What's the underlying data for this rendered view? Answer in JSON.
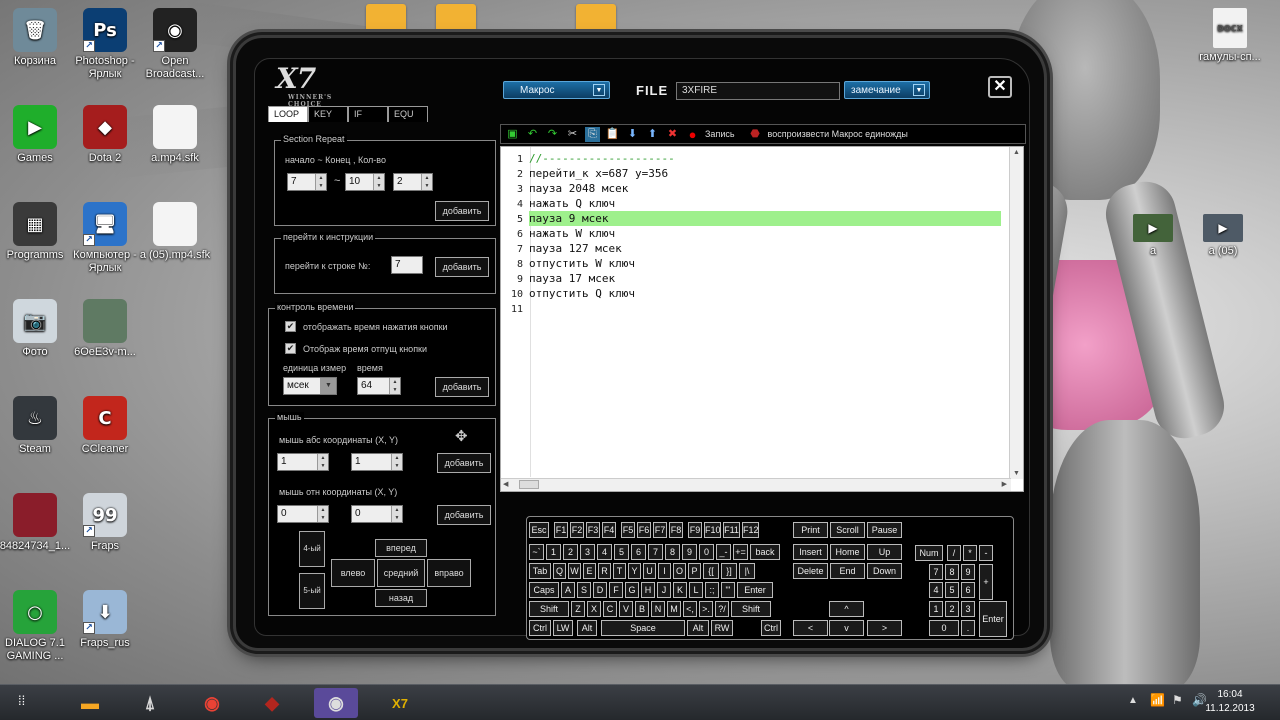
{
  "desktop": {
    "icons_left": [
      {
        "label": "Корзина",
        "glyph": "🗑",
        "color": "#6f8a99",
        "shortcut": false
      },
      {
        "label": "Photoshop - Ярлык",
        "glyph": "Ps",
        "color": "#0b3e73",
        "shortcut": true
      },
      {
        "label": "Open Broadcast...",
        "glyph": "◉",
        "color": "#222222",
        "shortcut": true
      },
      {
        "label": "Games",
        "glyph": "▶",
        "color": "#1fae2b",
        "shortcut": false
      },
      {
        "label": "Dota 2",
        "glyph": "◆",
        "color": "#a51d1d",
        "shortcut": false
      },
      {
        "label": "a.mp4.sfk",
        "glyph": "",
        "color": "#f4f4f4",
        "shortcut": false
      },
      {
        "label": "Programms",
        "glyph": "▦",
        "color": "#3a3a3a",
        "shortcut": false
      },
      {
        "label": "Компьютер - Ярлык",
        "glyph": "🖥",
        "color": "#2c73c9",
        "shortcut": true
      },
      {
        "label": "a (05).mp4.sfk",
        "glyph": "",
        "color": "#f4f4f4",
        "shortcut": false
      },
      {
        "label": "Фото",
        "glyph": "📷",
        "color": "#cfd7dd",
        "shortcut": false
      },
      {
        "label": "6OeE3v-m...",
        "glyph": "",
        "color": "#5f7a63",
        "shortcut": false
      },
      {
        "label": "Steam",
        "glyph": "♨",
        "color": "#33383d",
        "shortcut": false
      },
      {
        "label": "CCleaner",
        "glyph": "C",
        "color": "#c2261c",
        "shortcut": false
      },
      {
        "label": "84824734_1...",
        "glyph": "",
        "color": "#8a1d2a",
        "shortcut": false
      },
      {
        "label": "Fraps",
        "glyph": "99",
        "color": "#cfd5db",
        "shortcut": true
      },
      {
        "label": "DIALOG 7.1 GAMING ...",
        "glyph": "○",
        "color": "#26a33a",
        "shortcut": false
      },
      {
        "label": "Fraps_rus",
        "glyph": "⬇",
        "color": "#9ab7d6",
        "shortcut": true
      }
    ],
    "icons_right": [
      {
        "label": "гамулы-сп...",
        "glyph": "DOCX",
        "color": "#f2f2f2"
      },
      {
        "label": "а",
        "glyph": "▶",
        "color": "#43633a"
      },
      {
        "label": "а (05)",
        "glyph": "▶",
        "color": "#4e5a66"
      }
    ],
    "top_folder_icons": [
      "#f2b233",
      "#f2b233",
      "#f2b233"
    ]
  },
  "app": {
    "logo": "X7",
    "logo_sub": "WINNER'S CHOICE",
    "macro_dropdown": "Макрос",
    "file_label": "FILE",
    "file_name": "3XFIRE",
    "note_dropdown": "замечание",
    "close_glyph": "✕",
    "tabs": [
      "LOOP",
      "KEY",
      "IF",
      "EQU"
    ],
    "section_repeat": {
      "title": "Section Repeat",
      "subtitle": "начало ~ Конец , Кол-во",
      "start": "7",
      "tilde": "~",
      "end": "10",
      "count": "2",
      "add": "добавить"
    },
    "goto": {
      "title": "перейти к инструкции",
      "label": "перейти к строке №:",
      "value": "7",
      "add": "добавить"
    },
    "time_control": {
      "title": "контроль времени",
      "check1": "отображать время нажатия кнопки",
      "check2": "Отображ время отпущ кнопки",
      "unit_label": "единица измер",
      "time_label": "время",
      "unit": "мсек",
      "time": "64",
      "add": "добавить"
    },
    "mouse": {
      "title": "мышь",
      "abs_label": "мышь абс координаты (X, Y)",
      "abs_x": "1",
      "abs_y": "1",
      "rel_label": "мышь отн координаты (X, Y)",
      "rel_x": "0",
      "rel_y": "0",
      "add": "добавить",
      "btn4": "4-ый",
      "btn5": "5-ый",
      "forward": "вперед",
      "left": "влево",
      "middle": "средний",
      "right": "вправо",
      "back": "назад"
    },
    "toolbar": {
      "record": "Запись",
      "play_once": "воспроизвести Макрос единожды"
    },
    "editor_lines": [
      {
        "n": "1",
        "text": "//--------------------",
        "hl": false
      },
      {
        "n": "2",
        "text": "перейти_к x=687 y=356",
        "hl": false
      },
      {
        "n": "3",
        "text": "пауза 2048 мсек",
        "hl": false
      },
      {
        "n": "4",
        "text": "нажать Q ключ",
        "hl": false
      },
      {
        "n": "5",
        "text": "пауза 9 мсек",
        "hl": true
      },
      {
        "n": "6",
        "text": "нажать W ключ",
        "hl": false
      },
      {
        "n": "7",
        "text": "пауза 127 мсек",
        "hl": false
      },
      {
        "n": "8",
        "text": "отпустить W ключ",
        "hl": false
      },
      {
        "n": "9",
        "text": "пауза 17 мсек",
        "hl": false
      },
      {
        "n": "10",
        "text": "отпустить Q ключ",
        "hl": false
      },
      {
        "n": "11",
        "text": "",
        "hl": false
      }
    ]
  },
  "keyboard": {
    "row_f": [
      "Esc",
      "F1",
      "F2",
      "F3",
      "F4",
      "F5",
      "F6",
      "F7",
      "F8",
      "F9",
      "F10",
      "F11",
      "F12"
    ],
    "nav_top": [
      "Print",
      "Scroll",
      "Pause"
    ],
    "row_num": [
      "~`",
      "1",
      "2",
      "3",
      "4",
      "5",
      "6",
      "7",
      "8",
      "9",
      "0",
      "_-",
      "+=",
      "back"
    ],
    "nav_mid1": [
      "Insert",
      "Home",
      "Up"
    ],
    "row_tab": [
      "Tab",
      "Q",
      "W",
      "E",
      "R",
      "T",
      "Y",
      "U",
      "I",
      "O",
      "P",
      "{[",
      "}]",
      "|\\"
    ],
    "nav_mid2": [
      "Delete",
      "End",
      "Down"
    ],
    "row_caps": [
      "Caps",
      "A",
      "S",
      "D",
      "F",
      "G",
      "H",
      "J",
      "K",
      "L",
      ":;",
      "\"'",
      "Enter"
    ],
    "row_shift": [
      "Shift",
      "Z",
      "X",
      "C",
      "V",
      "B",
      "N",
      "M",
      "<,",
      ">.",
      "?/",
      "Shift"
    ],
    "row_ctrl": [
      "Ctrl",
      "LW",
      "Alt",
      "Space",
      "Alt",
      "RW",
      "Ctrl"
    ],
    "arrows": [
      "^",
      "<",
      "v",
      ">"
    ],
    "numpad": [
      "Num",
      "/",
      "*",
      "-",
      "7",
      "8",
      "9",
      "+",
      "4",
      "5",
      "6",
      "1",
      "2",
      "3",
      "Enter",
      "0",
      "."
    ]
  },
  "taskbar": {
    "time": "16:04",
    "date": "11.12.2013",
    "apps": [
      {
        "name": "file-explorer",
        "glyph": "▬",
        "color": "#f5a623"
      },
      {
        "name": "assassins-creed",
        "glyph": "⍋",
        "color": "#d8d8d8"
      },
      {
        "name": "chrome",
        "glyph": "◉",
        "color": "#e94235"
      },
      {
        "name": "dota2",
        "glyph": "◆",
        "color": "#b3261e"
      },
      {
        "name": "obs",
        "glyph": "◉",
        "color": "#dddddd"
      },
      {
        "name": "x7",
        "glyph": "X7",
        "color": "#e0b000"
      }
    ]
  }
}
